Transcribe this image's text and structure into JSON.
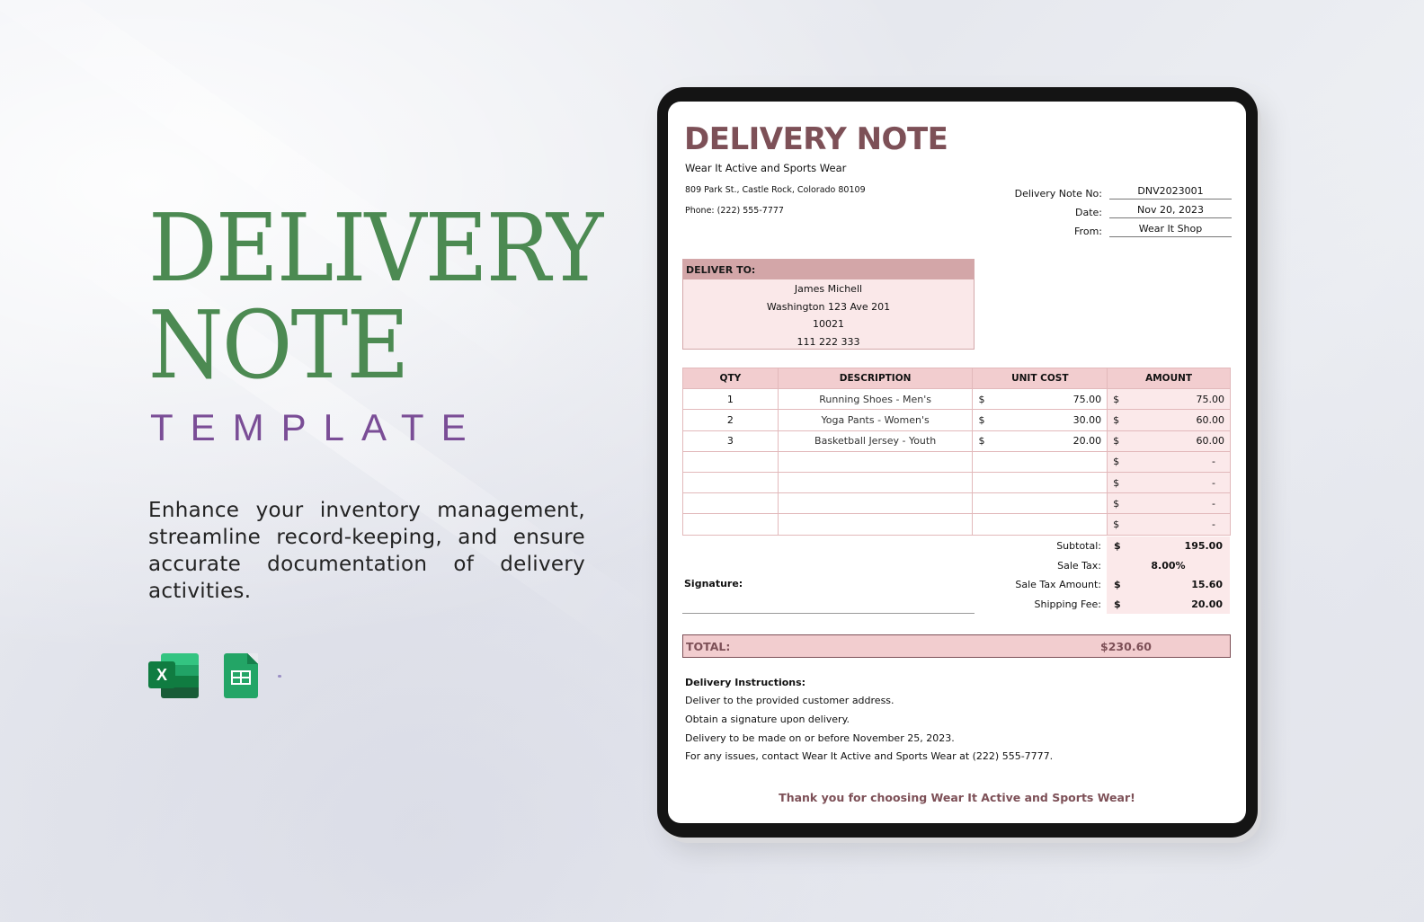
{
  "promo": {
    "title_line1": "DELIVERY",
    "title_line2": "NOTE",
    "subtitle": "TEMPLATE",
    "description": "Enhance your inventory management, streamline record-keeping, and ensure accurate documentation of delivery activities.",
    "app_icons": [
      {
        "name": "excel-icon",
        "letter": "X"
      },
      {
        "name": "google-sheets-icon"
      }
    ]
  },
  "document": {
    "title": "DELIVERY NOTE",
    "company": "Wear It Active and Sports Wear",
    "address": "809 Park St., Castle Rock, Colorado 80109",
    "phone": "Phone: (222) 555-7777",
    "meta": [
      {
        "label": "Delivery Note No:",
        "value": "DNV2023001"
      },
      {
        "label": "Date:",
        "value": "Nov 20, 2023"
      },
      {
        "label": "From:",
        "value": "Wear It Shop"
      }
    ],
    "deliver_to": {
      "heading": "DELIVER TO:",
      "lines": [
        "James Michell",
        "Washington 123 Ave 201",
        "10021",
        "111 222 333"
      ]
    },
    "table": {
      "headers": [
        "QTY",
        "DESCRIPTION",
        "UNIT COST",
        "AMOUNT"
      ],
      "currency": "$",
      "rows": [
        {
          "qty": "1",
          "description": "Running Shoes - Men's",
          "unit_cost": "75.00",
          "amount": "75.00"
        },
        {
          "qty": "2",
          "description": "Yoga Pants - Women's",
          "unit_cost": "30.00",
          "amount": "60.00"
        },
        {
          "qty": "3",
          "description": "Basketball Jersey - Youth",
          "unit_cost": "20.00",
          "amount": "60.00"
        },
        {
          "qty": "",
          "description": "",
          "unit_cost": "",
          "amount": "-"
        },
        {
          "qty": "",
          "description": "",
          "unit_cost": "",
          "amount": "-"
        },
        {
          "qty": "",
          "description": "",
          "unit_cost": "",
          "amount": "-"
        },
        {
          "qty": "",
          "description": "",
          "unit_cost": "",
          "amount": "-"
        }
      ]
    },
    "summary": [
      {
        "label": "Subtotal:",
        "currency": "$",
        "value": "195.00"
      },
      {
        "label": "Sale Tax:",
        "currency": "",
        "value": "8.00%"
      },
      {
        "label": "Sale Tax Amount:",
        "currency": "$",
        "value": "15.60"
      },
      {
        "label": "Shipping Fee:",
        "currency": "$",
        "value": "20.00"
      }
    ],
    "signature_label": "Signature:",
    "total": {
      "label": "TOTAL:",
      "value": "$230.60"
    },
    "instructions": {
      "heading": "Delivery Instructions:",
      "lines": [
        "Deliver to the provided customer address.",
        "Obtain a signature upon delivery.",
        "Delivery to be made on or before November 25, 2023.",
        "For any issues, contact Wear It Active and Sports Wear at (222) 555-7777."
      ]
    },
    "thank_you": "Thank you for choosing Wear It Active and Sports Wear!"
  },
  "colors": {
    "promo_green": "#4c8a52",
    "promo_purple": "#7a4d96",
    "doc_accent": "#7d5057",
    "table_header_pink": "#f2cdcf",
    "light_pink": "#fbe9ea",
    "deliver_header": "#d3a6a8"
  }
}
